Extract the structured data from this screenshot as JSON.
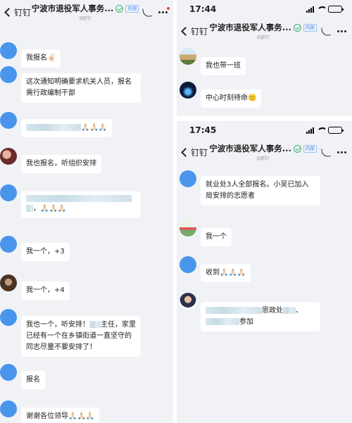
{
  "left": {
    "nav": {
      "back_label": "钉钉",
      "title": "宁波市退役军人事务...",
      "tag": "内部",
      "subtitle": "派欧钉"
    },
    "messages": [
      {
        "text": "我报名✌🏻"
      },
      {
        "text": "这次通知明确要求机关人员，报名需行政编制干部"
      },
      {
        "text": "🙏🏻🙏🏻🙏🏻"
      },
      {
        "text": "我也报名，听组织安排"
      },
      {
        "text": "，🙏🏻🙏🏻🙏🏻"
      },
      {
        "text": "我一个，+3"
      },
      {
        "text": "我一个，+4"
      },
      {
        "text_a": "我也一个，听安排！",
        "text_b": "主任，家里已经有一个在乡镇街道一直坚守的同志尽量不要安排了！"
      },
      {
        "text": "报名"
      },
      {
        "text": "谢谢各位领导🙏🏻🙏🏻🙏🏻"
      }
    ]
  },
  "right_top": {
    "time": "17:44",
    "battery_level": 0.65,
    "nav": {
      "back_label": "钉钉",
      "title": "宁波市退役军人事务...",
      "tag": "内部",
      "subtitle": "派欧钉"
    },
    "messages": [
      {
        "text": "我也带一班"
      },
      {
        "text": "中心时刻待命🙂"
      }
    ]
  },
  "right_bottom": {
    "time": "17:45",
    "battery_level": 0.65,
    "nav": {
      "back_label": "钉钉",
      "title": "宁波市退役军人事务...",
      "tag": "内部",
      "subtitle": "派欧钉"
    },
    "messages": [
      {
        "text": "就业处3人全部报名。小吴已加入局安排的志愿者"
      },
      {
        "text": "我一个"
      },
      {
        "text": "收到🙏🏻🙏🏻🙏🏻"
      },
      {
        "text_a": "思政处",
        "text_b": "、",
        "text_c": "参加"
      }
    ]
  },
  "colors": {
    "accent": "#4a95ec",
    "background": "#f1f2f6",
    "bubble": "#ffffff",
    "verified": "#38b46b",
    "tag": "#3a86ff",
    "notification": "#f0452f"
  }
}
